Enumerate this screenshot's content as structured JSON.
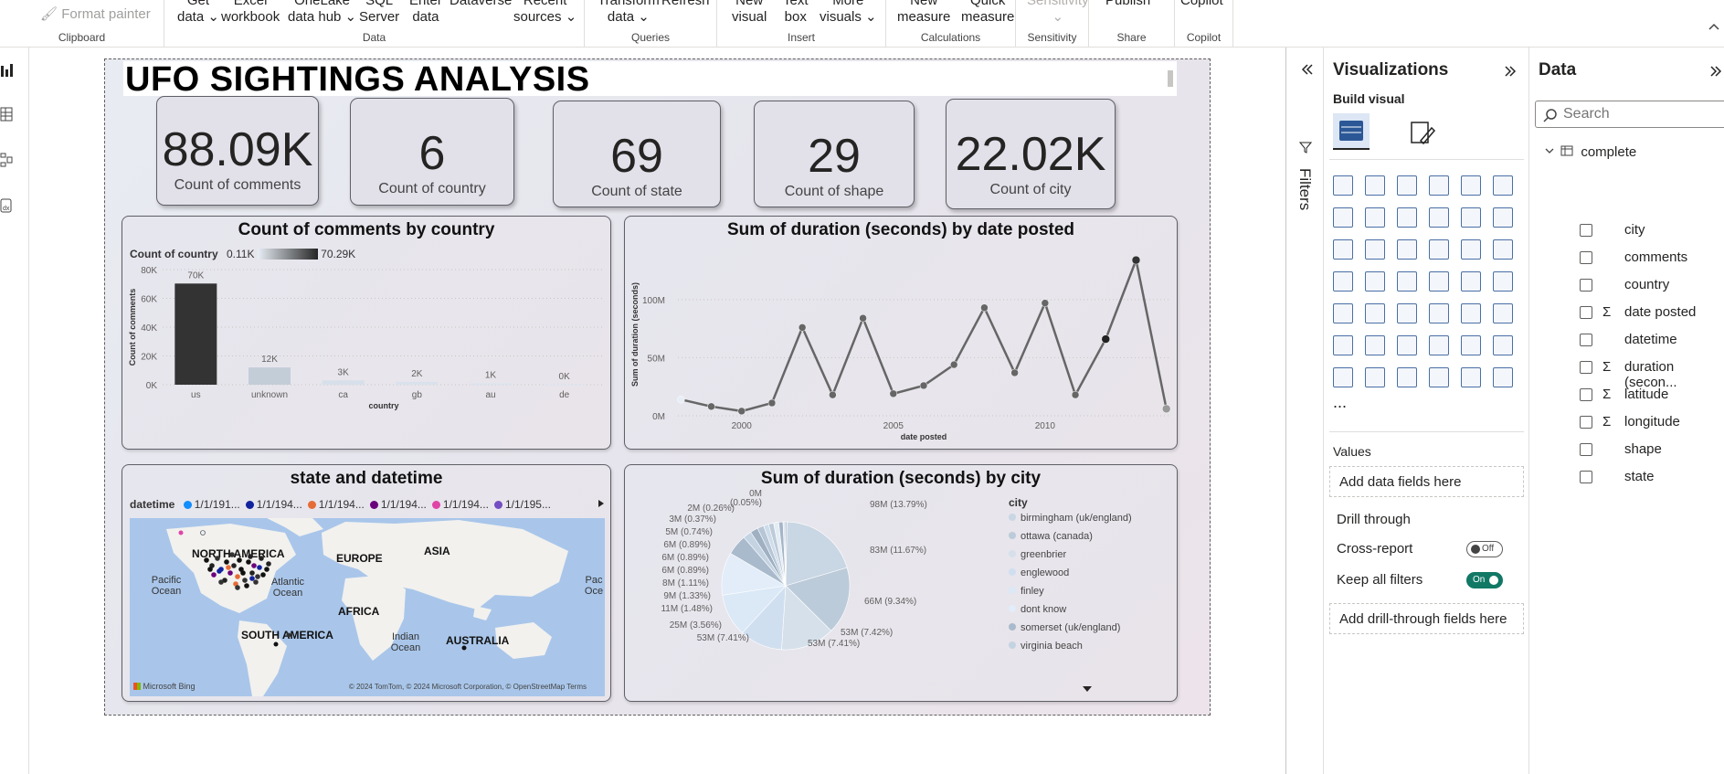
{
  "ribbon": {
    "format_painter": "Format painter",
    "groups": {
      "clipboard": "Clipboard",
      "data": "Data",
      "queries": "Queries",
      "insert": "Insert",
      "calculations": "Calculations",
      "sensitivity": "Sensitivity",
      "share": "Share",
      "copilot": "Copilot"
    },
    "buttons": {
      "get_data": [
        "Get",
        "data"
      ],
      "excel": [
        "Excel",
        "workbook"
      ],
      "onelake": [
        "OneLake",
        "data hub"
      ],
      "sql": [
        "SQL",
        "Server"
      ],
      "enter_data": [
        "Enter",
        "data"
      ],
      "dataverse": [
        "Dataverse",
        ""
      ],
      "recent": [
        "Recent",
        "sources"
      ],
      "transform": [
        "Transform",
        "data"
      ],
      "refresh": [
        "Refresh",
        ""
      ],
      "new_visual": [
        "New",
        "visual"
      ],
      "text_box": [
        "Text",
        "box"
      ],
      "more_visuals": [
        "More",
        "visuals"
      ],
      "new_measure": [
        "New",
        "measure"
      ],
      "quick_measure": [
        "Quick",
        "measure"
      ],
      "sensitivity": [
        "Sensitivity",
        ""
      ],
      "publish": [
        "Publish",
        ""
      ],
      "copilot": [
        "Copilot",
        ""
      ]
    }
  },
  "report": {
    "title": "UFO SIGHTINGS ANALYSIS",
    "kpis": [
      {
        "value": "88.09K",
        "label": "Count of comments"
      },
      {
        "value": "6",
        "label": "Count of country"
      },
      {
        "value": "69",
        "label": "Count of state"
      },
      {
        "value": "29",
        "label": "Count of shape"
      },
      {
        "value": "22.02K",
        "label": "Count of city"
      }
    ],
    "bar_panel": {
      "title": "Count of comments by country",
      "legend_label": "Count of country",
      "legend_min": "0.11K",
      "legend_max": "70.29K"
    },
    "line_panel": {
      "title": "Sum of duration (seconds) by date posted"
    },
    "map_panel": {
      "title": "state and datetime",
      "legend_label": "datetime",
      "legend_items": [
        "1/1/191...",
        "1/1/194...",
        "1/1/194...",
        "1/1/194...",
        "1/1/194...",
        "1/1/195..."
      ],
      "legend_colors": [
        "#118dff",
        "#12239e",
        "#e66c37",
        "#6b007b",
        "#e044a7",
        "#744ec2"
      ],
      "labels": {
        "north_america": "NORTH AMERICA",
        "europe": "EUROPE",
        "asia": "ASIA",
        "africa": "AFRICA",
        "south_america": "SOUTH AMERICA",
        "australia": "AUSTRALIA",
        "pacific_left": "Pacific Ocean",
        "atlantic": "Atlantic Ocean",
        "indian": "Indian Ocean",
        "pacific_right": "Pac Oce"
      },
      "bing": "Microsoft Bing",
      "copyright": "© 2024 TomTom, © 2024 Microsoft Corporation, © OpenStreetMap  Terms"
    },
    "pie_panel": {
      "title": "Sum of duration (seconds) by city",
      "legend_title": "city"
    }
  },
  "chart_data": [
    {
      "type": "bar",
      "title": "Count of comments by country",
      "xlabel": "country",
      "ylabel": "Count of comments",
      "categories": [
        "us",
        "unknown",
        "ca",
        "gb",
        "au",
        "de"
      ],
      "values": [
        70290,
        12000,
        3000,
        2000,
        1000,
        110
      ],
      "data_labels": [
        "70K",
        "12K",
        "3K",
        "2K",
        "1K",
        "0K"
      ],
      "yticks": [
        "0K",
        "20K",
        "40K",
        "60K",
        "80K"
      ],
      "ylim": [
        0,
        80000
      ],
      "colors": [
        "#333333",
        "#c3cdd7",
        "#d7e0ea",
        "#d9e2ec",
        "#dbe4ee",
        "#dde6f0"
      ]
    },
    {
      "type": "line",
      "title": "Sum of duration (seconds) by date posted",
      "xlabel": "date posted",
      "ylabel": "Sum of duration (seconds)",
      "x": [
        1998,
        1999,
        2000,
        2001,
        2002,
        2003,
        2004,
        2005,
        2006,
        2007,
        2008,
        2009,
        2010,
        2011,
        2012,
        2013,
        2014
      ],
      "y": [
        14,
        8,
        4,
        11,
        76,
        18,
        84,
        19,
        26,
        44,
        93,
        37,
        97,
        18,
        66,
        134,
        6
      ],
      "y_unit": "M",
      "yticks": [
        "0M",
        "50M",
        "100M"
      ],
      "xticks": [
        "2000",
        "2005",
        "2010"
      ],
      "ylim": [
        0,
        140
      ]
    },
    {
      "type": "pie",
      "title": "Sum of duration (seconds) by city",
      "legend": [
        "birmingham (uk/england)",
        "ottawa (canada)",
        "greenbrier",
        "englewood",
        "finley",
        "dont know",
        "somerset (uk/england)",
        "virginia beach"
      ],
      "slice_labels": [
        "98M (13.79%)",
        "83M (11.67%)",
        "66M (9.34%)",
        "53M (7.42%)",
        "53M (7.41%)",
        "53M (7.41%)",
        "25M (3.56%)",
        "11M (1.48%)",
        "9M (1.33%)",
        "8M (1.11%)",
        "6M (0.89%)",
        "6M (0.89%)",
        "6M (0.89%)",
        "5M (0.74%)",
        "3M (0.37%)",
        "2M (0.26%)",
        "(0.05%)",
        "0M"
      ],
      "values_pct": [
        13.79,
        11.67,
        9.34,
        7.42,
        7.41,
        7.41,
        3.56,
        1.48,
        1.33,
        1.11,
        0.89,
        0.89,
        0.89,
        0.74,
        0.37,
        0.26,
        0.05
      ]
    }
  ],
  "filters": {
    "label": "Filters"
  },
  "visualizations": {
    "title": "Visualizations",
    "build_visual": "Build visual",
    "more": "...",
    "values_label": "Values",
    "values_well": "Add data fields here",
    "drill_through": "Drill through",
    "cross_report": "Cross-report",
    "cross_report_state": "Off",
    "keep_filters": "Keep all filters",
    "keep_filters_state": "On",
    "drill_well": "Add drill-through fields here"
  },
  "data_pane": {
    "title": "Data",
    "search_placeholder": "Search",
    "table": "complete",
    "fields": [
      {
        "name": "city",
        "sigma": false
      },
      {
        "name": "comments",
        "sigma": false
      },
      {
        "name": "country",
        "sigma": false
      },
      {
        "name": "date posted",
        "sigma": true
      },
      {
        "name": "datetime",
        "sigma": false
      },
      {
        "name": "duration (secon...",
        "sigma": true
      },
      {
        "name": "latitude",
        "sigma": true
      },
      {
        "name": "longitude",
        "sigma": true
      },
      {
        "name": "shape",
        "sigma": false
      },
      {
        "name": "state",
        "sigma": false
      }
    ]
  }
}
